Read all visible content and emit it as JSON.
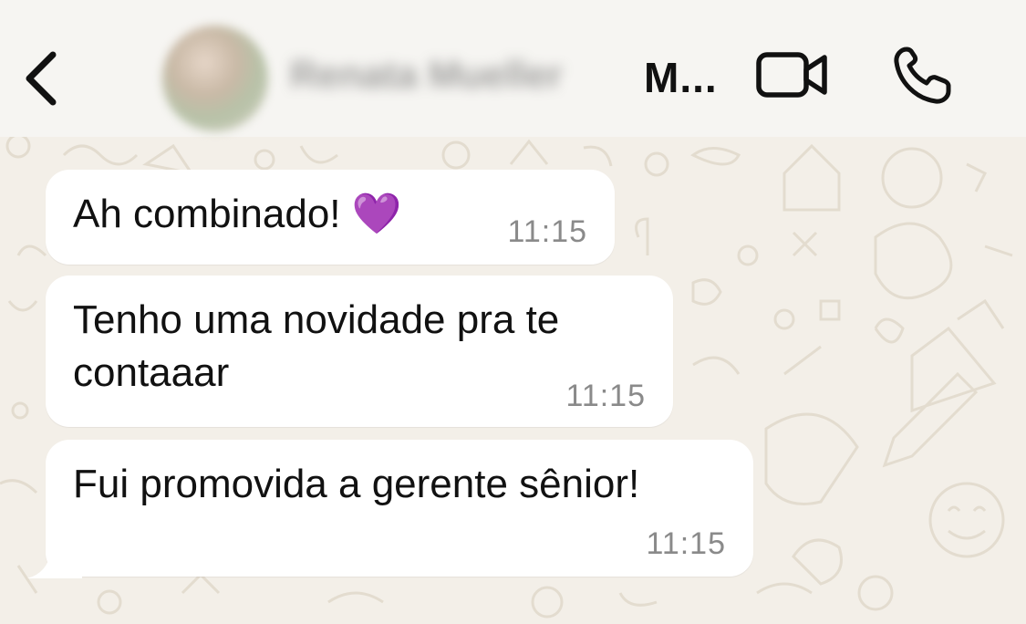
{
  "header": {
    "contact_name": "Renata Mueller",
    "contact_name_truncated": "M...",
    "back_icon": "chevron-left-icon",
    "video_icon": "video-camera-icon",
    "call_icon": "phone-icon"
  },
  "messages": [
    {
      "text": "Ah combinado! 💜",
      "time": "11:15"
    },
    {
      "text": "Tenho uma novidade pra te\ncontaaar",
      "time": "11:15"
    },
    {
      "text": "Fui promovida a gerente sênior!",
      "time": "11:15"
    }
  ],
  "colors": {
    "header_bg": "#f6f5f2",
    "chat_bg": "#f3efe8",
    "bubble_bg": "#ffffff",
    "time_text": "#8a8a8a",
    "primary_text": "#111111"
  }
}
